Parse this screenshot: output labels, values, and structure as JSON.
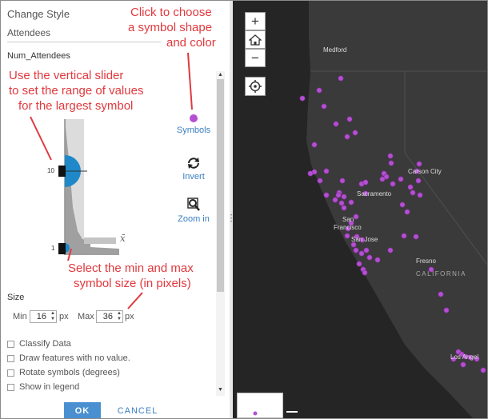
{
  "panel": {
    "title": "Change Style",
    "attribute": "Attendees",
    "field_name": "Num_Attendees"
  },
  "slider": {
    "max_label": "10",
    "min_label": "1",
    "mean_symbol": "x̄"
  },
  "controls": {
    "symbols_label": "Symbols",
    "invert_label": "Invert",
    "zoom_label": "Zoom in"
  },
  "size": {
    "heading": "Size",
    "min_label": "Min",
    "min_value": "16",
    "max_label": "Max",
    "max_value": "36",
    "unit": "px"
  },
  "options": [
    {
      "label": "Classify Data"
    },
    {
      "label": "Draw features with no value."
    },
    {
      "label": "Rotate symbols (degrees)"
    },
    {
      "label": "Show in legend"
    }
  ],
  "buttons": {
    "ok": "OK",
    "cancel": "CANCEL"
  },
  "map": {
    "zoom_in": "+",
    "zoom_out": "−",
    "cities": {
      "medford": "Medford",
      "carson_city": "Carson City",
      "sacramento": "Sacramento",
      "san": "San",
      "francisco": "Francisco",
      "san_jose": "San Jose",
      "fresno": "Fresno",
      "los_angeles": "Los Angel"
    },
    "region": "CALIFORNIA"
  },
  "annotations": {
    "symbol_line1": "Click to choose",
    "symbol_line2": "a symbol shape",
    "symbol_line3": "and color",
    "slider_line1": "Use the vertical slider",
    "slider_line2": "to set the range of values",
    "slider_line3": "for the largest symbol",
    "size_line1": "Select the min and max",
    "size_line2": "symbol size (in pixels)"
  },
  "colors": {
    "accent": "#3a7fc0",
    "ok_button": "#4a90d0",
    "symbol": "#b44fd1",
    "annotation": "#e0393e",
    "handle_fill": "#1e88c8",
    "map_background": "#252525"
  }
}
